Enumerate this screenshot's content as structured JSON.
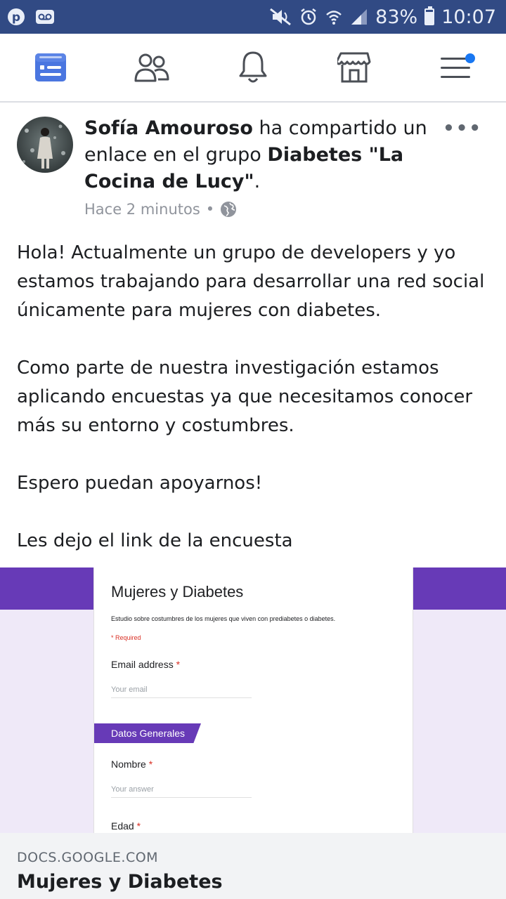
{
  "status_bar": {
    "battery_text": "83%",
    "battery_level": 0.83,
    "time": "10:07",
    "icons": [
      "pinterest-icon",
      "voicemail-icon",
      "mute-icon",
      "alarm-icon",
      "wifi-icon",
      "signal-icon",
      "battery-icon"
    ]
  },
  "nav": {
    "items": [
      "news-feed-icon",
      "friends-icon",
      "notifications-icon",
      "marketplace-icon",
      "menu-icon"
    ],
    "accent": "#1877f2"
  },
  "post": {
    "author": "Sofía Amouroso",
    "action_text": " ha compartido un enlace en el grupo ",
    "group": "Diabetes \"La Cocina de Lucy\"",
    "period": ".",
    "time": "Hace 2 minutos",
    "separator": "•",
    "paragraphs": [
      "Hola! Actualmente un grupo de developers y yo estamos trabajando para desarrollar una red social únicamente para mujeres con diabetes.",
      "Como parte de nuestra investigación estamos aplicando encuestas ya que  necesitamos conocer más su entorno y costumbres.",
      "Espero puedan apoyarnos!",
      "Les dejo el link de la encuesta"
    ]
  },
  "preview": {
    "form_title": "Mujeres y Diabetes",
    "form_description": "Estudio sobre costumbres de los mujeres que viven con prediabetes o diabetes.",
    "required_note": "* Required",
    "email_label": "Email address",
    "email_placeholder": "Your email",
    "section_label": "Datos Generales",
    "nombre_label": "Nombre",
    "nombre_placeholder": "Your answer",
    "edad_label": "Edad",
    "required_star": "*",
    "domain": "DOCS.GOOGLE.COM",
    "link_title": "Mujeres y Diabetes",
    "accent": "#673ab7"
  }
}
